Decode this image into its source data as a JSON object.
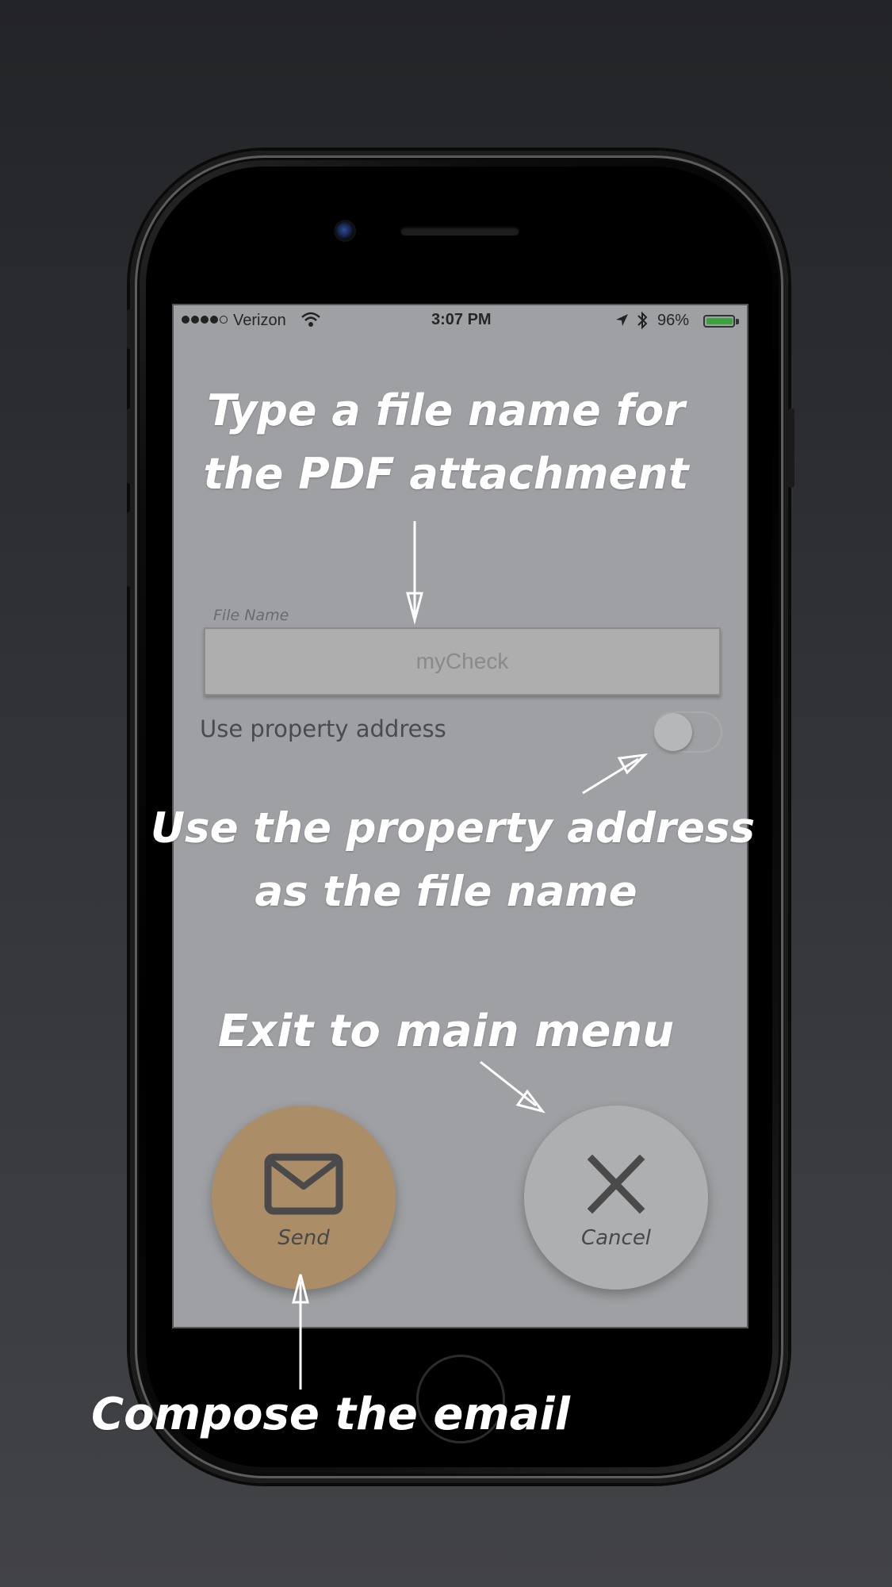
{
  "status_bar": {
    "carrier": "Verizon",
    "time": "3:07 PM",
    "battery": "96%"
  },
  "form": {
    "file_label": "File Name",
    "file_value": "myCheck",
    "toggle_label": "Use property address",
    "toggle_on": false
  },
  "buttons": {
    "send_label": "Send",
    "cancel_label": "Cancel"
  },
  "callouts": {
    "type_line1": "Type a file name for",
    "type_line2": "the PDF attachment",
    "use_line1": "Use the property address",
    "use_line2": "as the file name",
    "exit": "Exit to main menu",
    "compose": "Compose the email"
  },
  "colors": {
    "screen_bg": "#9ea0a3",
    "send_button": "#ab8e67",
    "cancel_button": "#aeafb1",
    "callout_text": "#ffffff",
    "battery_fill": "#3aa23a"
  },
  "icons": {
    "send": "envelope-icon",
    "cancel": "close-icon",
    "wifi": "wifi-icon",
    "location": "location-arrow-icon",
    "bluetooth": "bluetooth-icon",
    "battery": "battery-icon"
  }
}
